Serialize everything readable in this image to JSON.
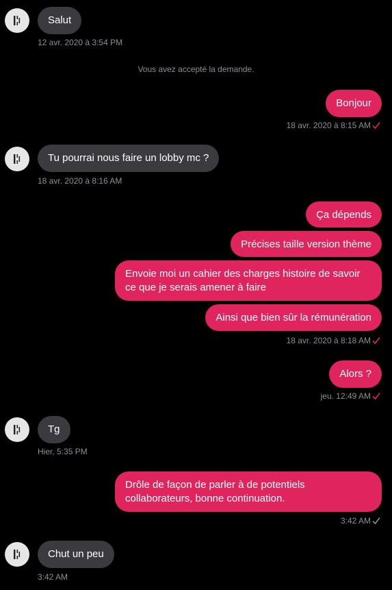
{
  "colors": {
    "outgoing_bubble": "#e0245e",
    "incoming_bubble": "#3b3b3f",
    "check_sent": "#e0245e",
    "check_read": "#8e8e93"
  },
  "system_message": "Vous avez accepté la demande.",
  "messages": [
    {
      "text": "Salut",
      "timestamp": "12 avr. 2020 à 3:54 PM"
    },
    {
      "text": "Bonjour",
      "timestamp": "18 avr. 2020 à 8:15 AM"
    },
    {
      "text": "Tu pourrai nous faire un lobby mc ?",
      "timestamp": "18 avr. 2020 à 8:16 AM"
    },
    {
      "text": "Ça dépends"
    },
    {
      "text": "Précises taille version thème"
    },
    {
      "text": "Envoie moi un cahier des charges histoire de savoir ce que je serais amener à faire"
    },
    {
      "text": "Ainsi que bien sûr la rémunération",
      "timestamp": "18 avr. 2020 à 8:18 AM"
    },
    {
      "text": "Alors ?",
      "timestamp": "jeu. 12:49 AM"
    },
    {
      "text": "Tg",
      "timestamp": "Hier, 5:35 PM"
    },
    {
      "text": "Drôle de façon de parler à de potentiels collaborateurs, bonne continuation.",
      "timestamp": "3:42 AM"
    },
    {
      "text": "Chut un peu",
      "timestamp": "3:42 AM"
    }
  ],
  "icons": {
    "avatar": "logo-avatar-icon",
    "check": "checkmark-icon"
  }
}
